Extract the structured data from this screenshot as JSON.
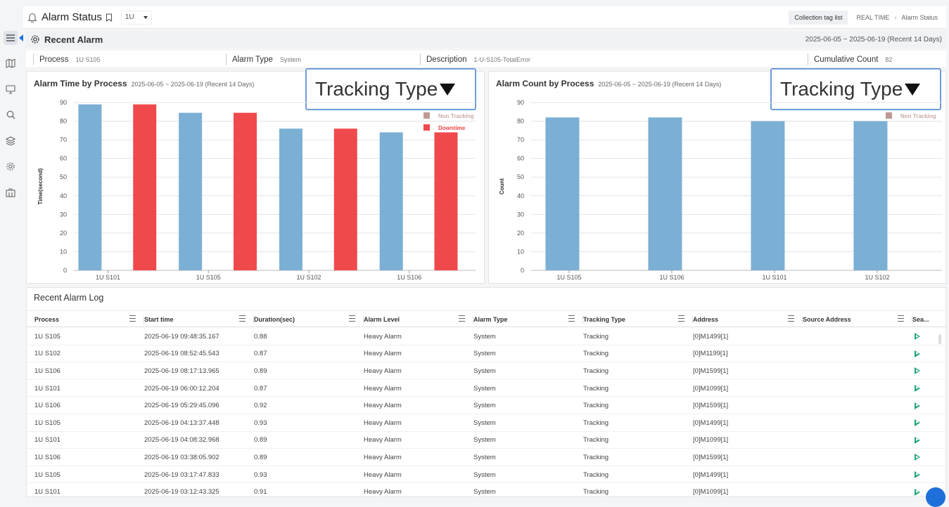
{
  "header": {
    "title": "Alarm Status",
    "unit_selected": "1U",
    "collection_button": "Collection tag list",
    "breadcrumb": [
      "REAL TIME",
      "Alarm Status"
    ]
  },
  "recent_alarm": {
    "title": "Recent Alarm",
    "range": "2025-06-05 ~ 2025-06-19 (Recent 14 Days)",
    "fields": {
      "process_label": "Process",
      "process_value": "1U S105",
      "alarm_type_label": "Alarm Type",
      "alarm_type_value": "System",
      "description_label": "Description",
      "description_value": "1-U-S105-TotalError",
      "count_label": "Cumulative Count",
      "count_value": "82"
    }
  },
  "colors": {
    "non_tracking": "#bf9a94",
    "downtime": "#f0494c",
    "bar_blue": "#7bafd4",
    "accent": "#1e6fd9"
  },
  "chart_data": [
    {
      "type": "bar",
      "title": "Alarm Time by Process",
      "subtitle": "2025-06-05 ~ 2025-06-19 (Recent 14 Days)",
      "ylabel": "Time(second)",
      "xlabel": "",
      "ylim": [
        0,
        90
      ],
      "yticks": [
        0,
        10,
        20,
        30,
        40,
        50,
        60,
        70,
        80,
        90
      ],
      "categories": [
        "1U S101",
        "1U S105",
        "1U S102",
        "1U S106"
      ],
      "legend": [
        "Non Tracking",
        "Downtime"
      ],
      "legend_position": "top-right",
      "grid": true,
      "series": [
        {
          "values": [
            89,
            84.5,
            76,
            74
          ]
        },
        {
          "name": "Downtime",
          "values": [
            89,
            84.5,
            76,
            74
          ]
        }
      ],
      "tracking_label": "Tracking Type"
    },
    {
      "type": "bar",
      "title": "Alarm Count by Process",
      "subtitle": "2025-06-05 ~ 2025-06-19 (Recent 14 Days)",
      "ylabel": "Count",
      "xlabel": "",
      "ylim": [
        0,
        90
      ],
      "yticks": [
        0,
        10,
        20,
        30,
        40,
        50,
        60,
        70,
        80,
        90
      ],
      "categories": [
        "1U S105",
        "1U S106",
        "1U S101",
        "1U S102"
      ],
      "legend": [
        "Non Tracking"
      ],
      "legend_position": "top-right",
      "grid": true,
      "series": [
        {
          "values": [
            82,
            82,
            80,
            80
          ]
        }
      ],
      "tracking_label": "Tracking Type"
    }
  ],
  "log": {
    "title": "Recent Alarm Log",
    "columns": [
      "Process",
      "Start time",
      "Duration(sec)",
      "Alarm Level",
      "Alarm Type",
      "Tracking Type",
      "Address",
      "Source Address",
      "Sea..."
    ],
    "rows": [
      [
        "1U S105",
        "2025-06-19 09:48:35.167",
        "0.88",
        "Heavy Alarm",
        "System",
        "Tracking",
        "[0]M1499[1]",
        ""
      ],
      [
        "1U S102",
        "2025-06-19 08:52:45.543",
        "0.87",
        "Heavy Alarm",
        "System",
        "Tracking",
        "[0]M1199[1]",
        ""
      ],
      [
        "1U S106",
        "2025-06-19 08:17:13.965",
        "0.89",
        "Heavy Alarm",
        "System",
        "Tracking",
        "[0]M1599[1]",
        ""
      ],
      [
        "1U S101",
        "2025-06-19 06:00:12.204",
        "0.87",
        "Heavy Alarm",
        "System",
        "Tracking",
        "[0]M1099[1]",
        ""
      ],
      [
        "1U S106",
        "2025-06-19 05:29:45.096",
        "0.92",
        "Heavy Alarm",
        "System",
        "Tracking",
        "[0]M1599[1]",
        ""
      ],
      [
        "1U S105",
        "2025-06-19 04:13:37.448",
        "0.93",
        "Heavy Alarm",
        "System",
        "Tracking",
        "[0]M1499[1]",
        ""
      ],
      [
        "1U S101",
        "2025-06-19 04:08:32.968",
        "0.89",
        "Heavy Alarm",
        "System",
        "Tracking",
        "[0]M1099[1]",
        ""
      ],
      [
        "1U S106",
        "2025-06-19 03:38:05.902",
        "0.89",
        "Heavy Alarm",
        "System",
        "Tracking",
        "[0]M1599[1]",
        ""
      ],
      [
        "1U S105",
        "2025-06-19 03:17:47.833",
        "0.93",
        "Heavy Alarm",
        "System",
        "Tracking",
        "[0]M1499[1]",
        ""
      ],
      [
        "1U S101",
        "2025-06-19 03:12:43.325",
        "0.91",
        "Heavy Alarm",
        "System",
        "Tracking",
        "[0]M1099[1]",
        ""
      ]
    ]
  }
}
